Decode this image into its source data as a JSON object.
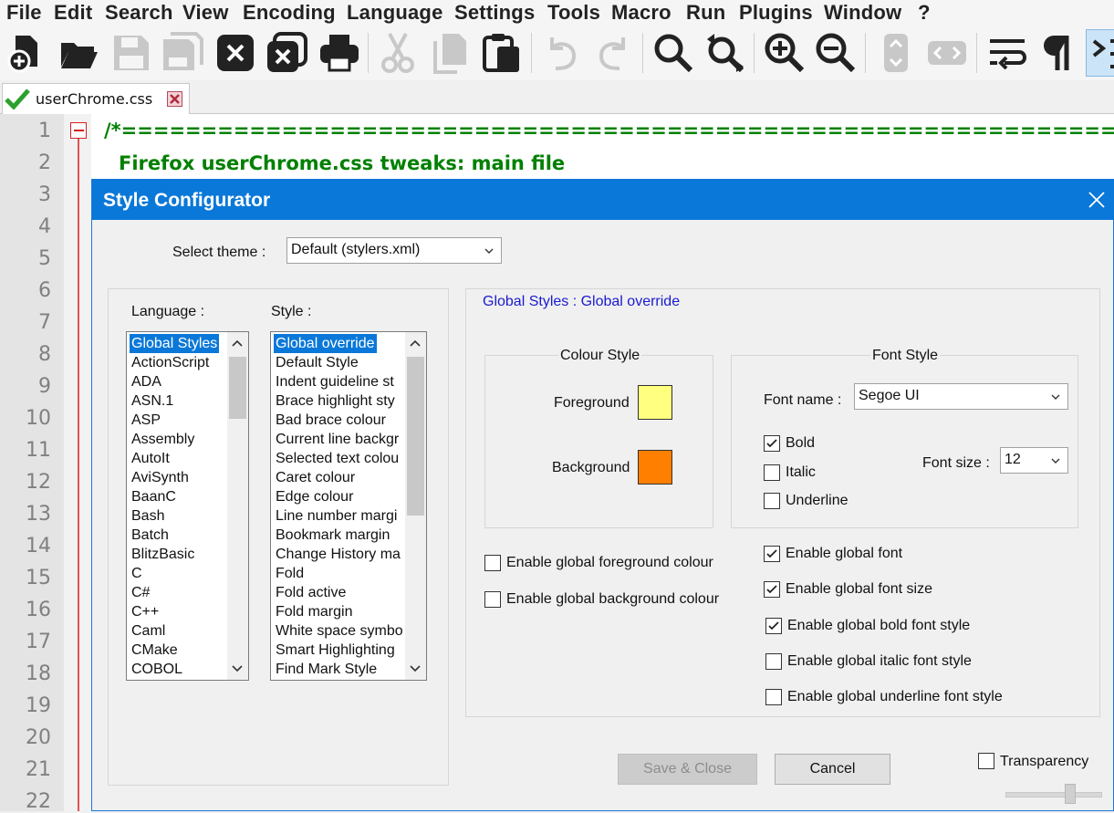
{
  "menu": [
    "File",
    "Edit",
    "Search",
    "View",
    "Encoding",
    "Language",
    "Settings",
    "Tools",
    "Macro",
    "Run",
    "Plugins",
    "Window",
    "?"
  ],
  "toolbar": {
    "icons": [
      "new-file-icon",
      "open-folder-icon",
      "save-icon",
      "save-all-icon",
      "close-icon",
      "close-all-icon",
      "print-icon",
      "cut-icon",
      "copy-icon",
      "paste-icon",
      "undo-icon",
      "redo-icon",
      "find-icon",
      "replace-icon",
      "zoom-in-icon",
      "zoom-out-icon",
      "sync-vertical-icon",
      "sync-horizontal-icon",
      "word-wrap-icon",
      "show-all-chars-icon",
      "indent-guide-icon"
    ]
  },
  "tab": {
    "label": "userChrome.css",
    "close_icon": "tab-close-icon",
    "status_icon": "saved-check-icon"
  },
  "editor": {
    "line_numbers": [
      "1",
      "2",
      "3",
      "4",
      "5",
      "6",
      "7",
      "8",
      "9",
      "10",
      "11",
      "12",
      "13",
      "14",
      "15",
      "16",
      "17",
      "18",
      "19",
      "20",
      "21",
      "22"
    ],
    "line1": "/*==================================================================",
    "line2": "Firefox userChrome.css tweaks: main file",
    "text_color": "#008000"
  },
  "dialog": {
    "title": "Style Configurator",
    "select_theme_label": "Select theme :",
    "theme_value": "Default (stylers.xml)",
    "language_label": "Language :",
    "style_label": "Style :",
    "languages": [
      "Global Styles",
      "ActionScript",
      "ADA",
      "ASN.1",
      "ASP",
      "Assembly",
      "AutoIt",
      "AviSynth",
      "BaanC",
      "Bash",
      "Batch",
      "BlitzBasic",
      "C",
      "C#",
      "C++",
      "Caml",
      "CMake",
      "COBOL"
    ],
    "styles": [
      "Global override",
      "Default Style",
      "Indent guideline st",
      "Brace highlight sty",
      "Bad brace colour",
      "Current line backgr",
      "Selected text colou",
      "Caret colour",
      "Edge colour",
      "Line number margi",
      "Bookmark margin",
      "Change History ma",
      "Fold",
      "Fold active",
      "Fold margin",
      "White space symbo",
      "Smart Highlighting",
      "Find Mark Style"
    ],
    "heading": "Global Styles : Global override",
    "colour_style_label": "Colour Style",
    "foreground_label": "Foreground",
    "background_label": "Background",
    "foreground_color": "#ffff80",
    "background_color": "#ff8000",
    "font_style_label": "Font Style",
    "font_name_label": "Font name :",
    "font_name_value": "Segoe UI",
    "bold_label": "Bold",
    "italic_label": "Italic",
    "underline_label": "Underline",
    "font_size_label": "Font size :",
    "font_size_value": "12",
    "bold_checked": true,
    "italic_checked": false,
    "underline_checked": false,
    "global_fg_label": "Enable global foreground colour",
    "global_bg_label": "Enable global background colour",
    "global_font_label": "Enable global font",
    "global_font_size_label": "Enable global font size",
    "global_bold_label": "Enable global bold font style",
    "global_italic_label": "Enable global italic font style",
    "global_underline_label": "Enable global underline font style",
    "save_close_label": "Save & Close",
    "cancel_label": "Cancel",
    "transparency_label": "Transparency",
    "accent_color": "#0a78d8"
  }
}
